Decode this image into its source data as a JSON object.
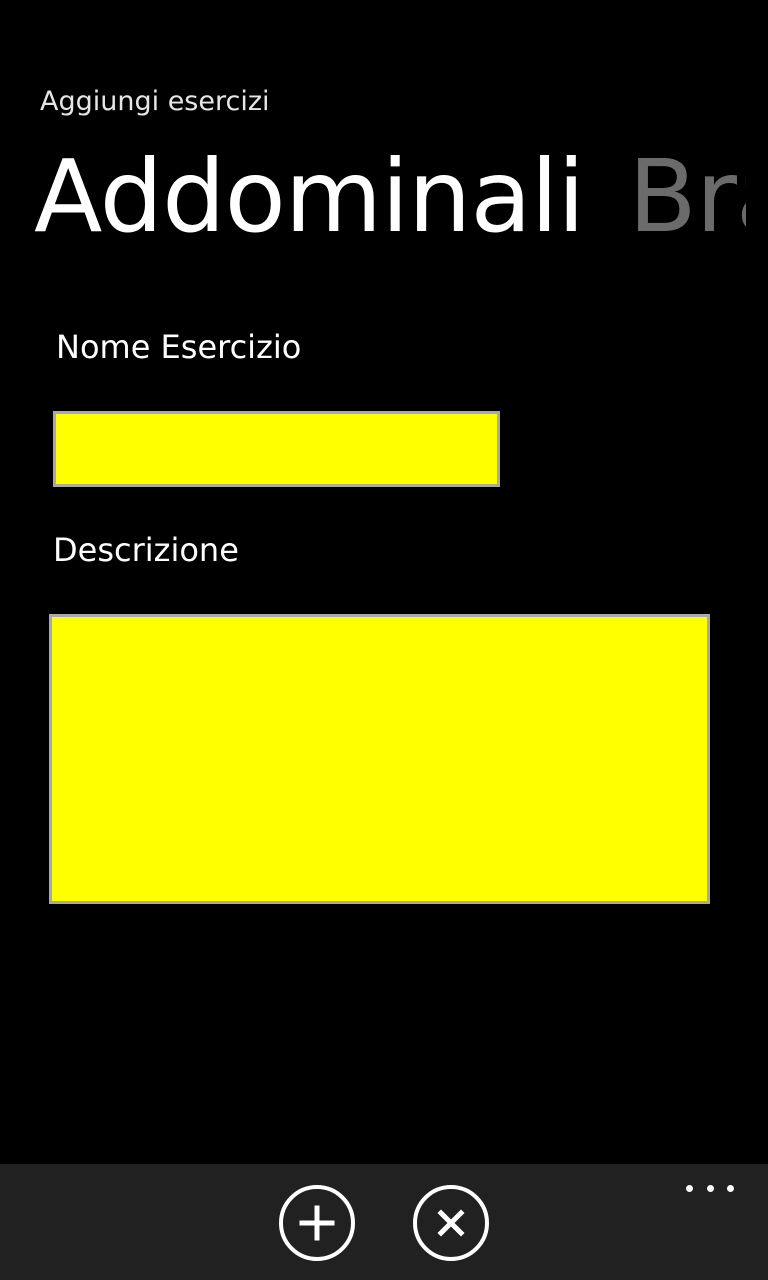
{
  "app": {
    "title": "Aggiungi esercizi"
  },
  "pivot": {
    "items": [
      {
        "label": "Addominali",
        "active": true
      },
      {
        "label": "Braccia",
        "active": false
      }
    ]
  },
  "form": {
    "name_label": "Nome Esercizio",
    "name_value": "",
    "description_label": "Descrizione",
    "description_value": ""
  },
  "app_bar": {
    "buttons": [
      {
        "icon": "add-icon"
      },
      {
        "icon": "cancel-icon"
      }
    ],
    "more_icon": "ellipsis-icon"
  },
  "colors": {
    "background": "#000000",
    "field_background": "#ffff00",
    "field_border": "#a9a9a9",
    "app_bar": "#212121",
    "pivot_inactive": "#6b6b6b"
  }
}
